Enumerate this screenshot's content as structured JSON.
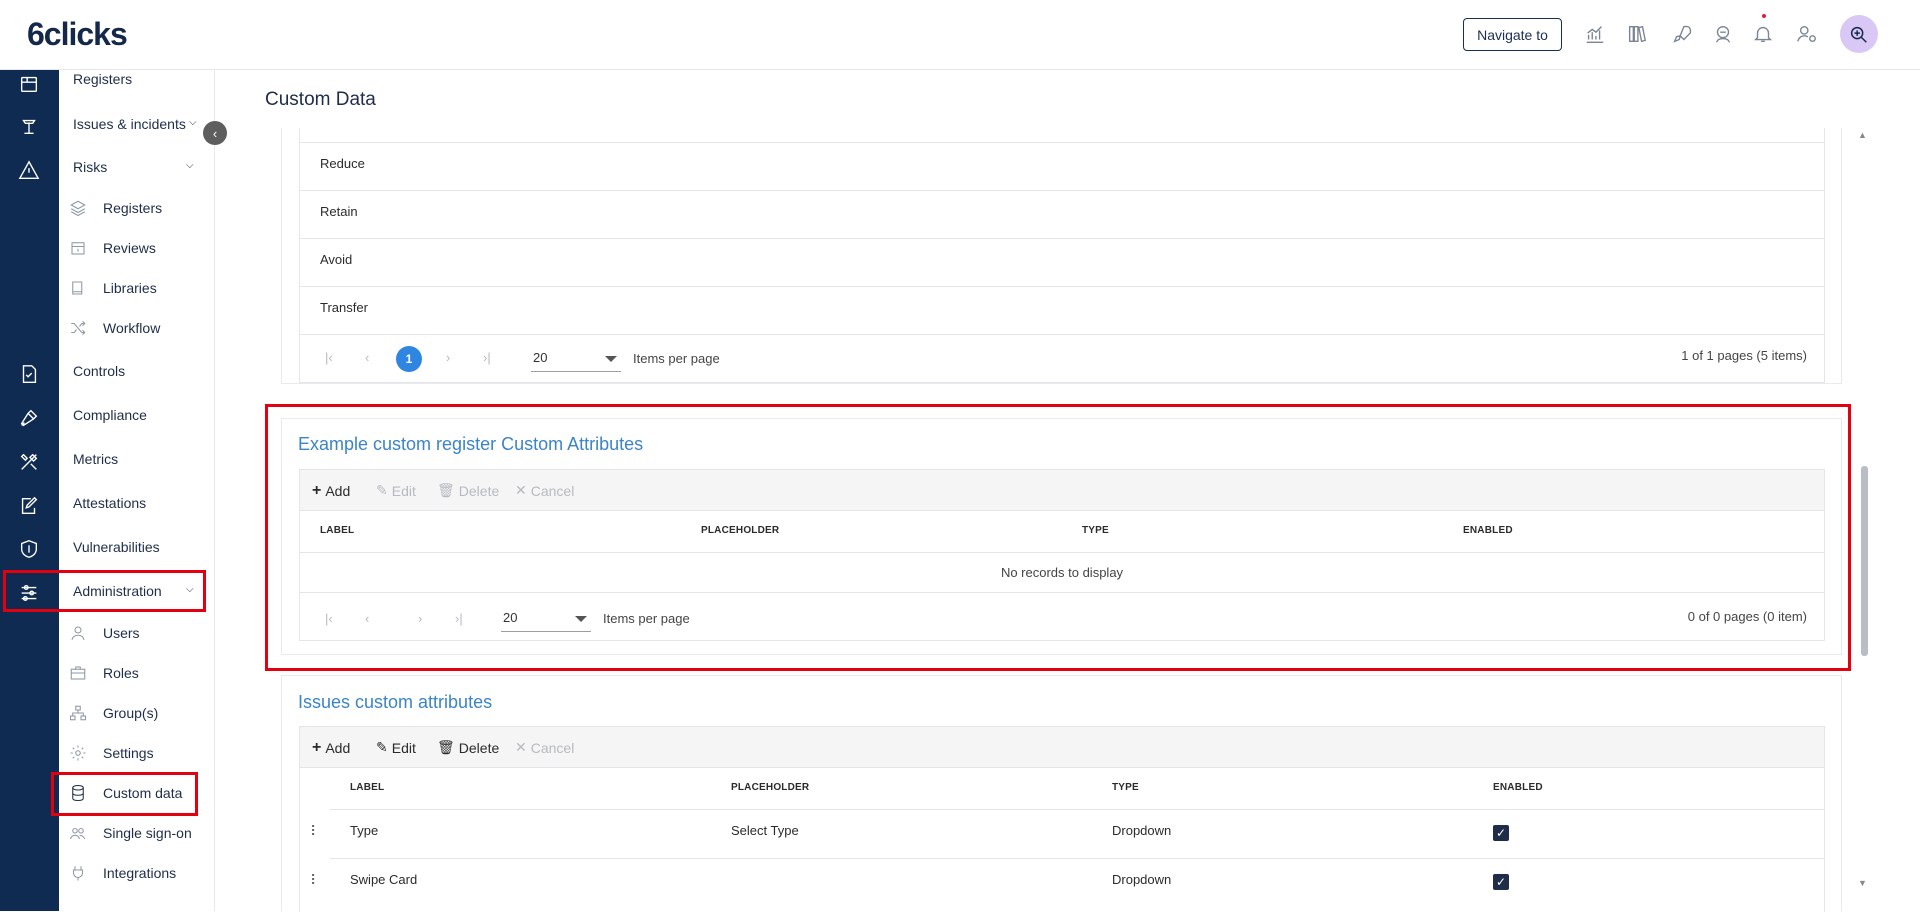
{
  "app": {
    "logo": "6clicks",
    "navigate_label": "Navigate to"
  },
  "topbar_icons": [
    "analytics-icon",
    "library-icon",
    "rocket-icon",
    "support-icon",
    "bell-icon",
    "user-settings-icon"
  ],
  "sidebar": {
    "registers": "Registers",
    "issues": "Issues & incidents",
    "risks": "Risks",
    "risks_sub": [
      "Registers",
      "Reviews",
      "Libraries",
      "Workflow"
    ],
    "controls": "Controls",
    "compliance": "Compliance",
    "metrics": "Metrics",
    "attestations": "Attestations",
    "vulnerabilities": "Vulnerabilities",
    "administration": "Administration",
    "admin_sub": [
      "Users",
      "Roles",
      "Group(s)",
      "Settings",
      "Custom data",
      "Single sign-on",
      "Integrations"
    ]
  },
  "page": {
    "title": "Custom Data"
  },
  "treatment_table": {
    "rows": [
      "Reduce",
      "Retain",
      "Avoid",
      "Transfer"
    ],
    "current_page": "1",
    "per_page": "20",
    "per_page_label": "Items per page",
    "summary": "1 of 1 pages (5 items)"
  },
  "register_attrs": {
    "title": "Example custom register Custom Attributes",
    "toolbar": {
      "add": "Add",
      "edit": "Edit",
      "delete": "Delete",
      "cancel": "Cancel"
    },
    "columns": [
      "LABEL",
      "PLACEHOLDER",
      "TYPE",
      "ENABLED"
    ],
    "empty": "No records to display",
    "per_page": "20",
    "per_page_label": "Items per page",
    "summary": "0 of 0 pages (0 item)"
  },
  "issues_attrs": {
    "title": "Issues custom attributes",
    "toolbar": {
      "add": "Add",
      "edit": "Edit",
      "delete": "Delete",
      "cancel": "Cancel"
    },
    "columns": [
      "LABEL",
      "PLACEHOLDER",
      "TYPE",
      "ENABLED"
    ],
    "rows": [
      {
        "label": "Type",
        "placeholder": "Select Type",
        "type": "Dropdown",
        "enabled": true
      },
      {
        "label": "Swipe Card",
        "placeholder": "",
        "type": "Dropdown",
        "enabled": true
      }
    ]
  },
  "colors": {
    "rail": "#0f2b52",
    "accent": "#3b84c7",
    "highlight": "#e3000f",
    "page_active": "#2f86e0"
  }
}
